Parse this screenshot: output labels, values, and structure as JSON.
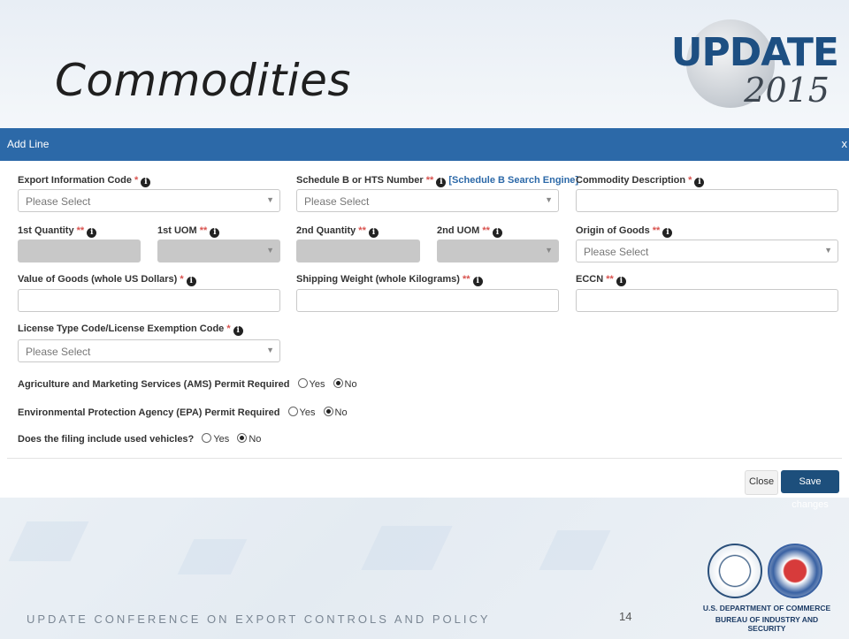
{
  "slide": {
    "title": "Commodities",
    "logo_word": "UPDATE",
    "logo_year": "2015",
    "footer": "UPDATE CONFERENCE ON EXPORT CONTROLS  AND POLICY",
    "page_number": "14",
    "dept_line1": "U.S. DEPARTMENT OF COMMERCE",
    "dept_line2": "BUREAU OF INDUSTRY AND SECURITY",
    "seal1_text": "DEPARTMENT OF COMMERCE · UNITED STATES OF AMERICA",
    "seal2_text": "BUREAU OF INDUSTRY AND SECURITY"
  },
  "modal": {
    "title": "Add Line",
    "close_glyph": "x",
    "required_single": "*",
    "required_double": "**",
    "info_glyph": "i",
    "fields": {
      "export_info_code": {
        "label": "Export Information Code",
        "placeholder": "Please Select"
      },
      "schedule_b": {
        "label": "Schedule B or HTS Number",
        "link": "[Schedule B Search Engine]",
        "placeholder": "Please Select"
      },
      "commodity_desc": {
        "label": "Commodity Description",
        "value": ""
      },
      "qty1": {
        "label": "1st Quantity"
      },
      "uom1": {
        "label": "1st UOM"
      },
      "qty2": {
        "label": "2nd Quantity"
      },
      "uom2": {
        "label": "2nd UOM"
      },
      "origin": {
        "label": "Origin of Goods",
        "placeholder": "Please Select"
      },
      "value_goods": {
        "label": "Value of Goods (whole US Dollars)",
        "value": ""
      },
      "ship_weight": {
        "label": "Shipping Weight (whole Kilograms)",
        "value": ""
      },
      "eccn": {
        "label": "ECCN",
        "value": ""
      },
      "license": {
        "label": "License Type Code/License Exemption Code",
        "placeholder": "Please Select"
      }
    },
    "questions": [
      {
        "text": "Agriculture and Marketing Services (AMS) Permit Required",
        "yes": "Yes",
        "no": "No",
        "selected": "No"
      },
      {
        "text": "Environmental Protection Agency (EPA) Permit Required",
        "yes": "Yes",
        "no": "No",
        "selected": "No"
      },
      {
        "text": "Does the filing include used vehicles?",
        "yes": "Yes",
        "no": "No",
        "selected": "No"
      }
    ],
    "buttons": {
      "close": "Close",
      "save": "Save changes"
    },
    "caret": "▼"
  }
}
